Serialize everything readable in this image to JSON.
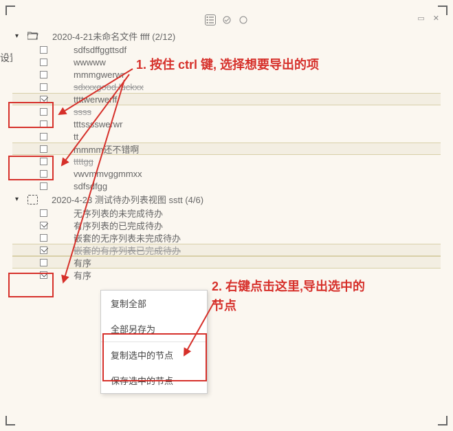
{
  "left_label": "设置",
  "topbar": {
    "list_icon": "≡",
    "check_icon": "✓",
    "circle_icon": "○"
  },
  "win": {
    "minimize": "▭",
    "close": "✕"
  },
  "groups": [
    {
      "title": "2020-4-21未命名文件 ffff (2/12)",
      "folder_type": "open",
      "items": [
        {
          "text": "sdfsdffggttsdf",
          "checked": false,
          "selected": false
        },
        {
          "text": "wwwww",
          "checked": false,
          "selected": false
        },
        {
          "text": "mmmgwerwr",
          "checked": false,
          "selected": false
        },
        {
          "text": "sdxxxgood luckxx",
          "checked": false,
          "selected": false,
          "done": true
        },
        {
          "text": "ttttwerwerff",
          "checked": true,
          "selected": true
        },
        {
          "text": "ssss",
          "checked": false,
          "selected": false,
          "done": true
        },
        {
          "text": "tttsssswerwr",
          "checked": false,
          "selected": false
        },
        {
          "text": "tt",
          "checked": false,
          "selected": false
        },
        {
          "text": "mmmm还不错啊",
          "checked": false,
          "selected": true
        },
        {
          "text": "ttttgg",
          "checked": false,
          "selected": false,
          "done": true
        },
        {
          "text": "vwvmmvggmmxx",
          "checked": false,
          "selected": false
        },
        {
          "text": "sdfsdfgg",
          "checked": false,
          "selected": false
        }
      ]
    },
    {
      "title": "2020-4-23 测试待办列表视图 sstt (4/6)",
      "folder_type": "dashed",
      "items": [
        {
          "text": "无序列表的未完成待办",
          "checked": false,
          "selected": false
        },
        {
          "text": "有序列表的已完成待办",
          "checked": true,
          "selected": false
        },
        {
          "text": "嵌套的无序列表未完成待办",
          "checked": false,
          "selected": false
        },
        {
          "text": "嵌套的有序列表已完成待办",
          "checked": true,
          "selected": true,
          "done": true
        },
        {
          "text": "有序",
          "checked": false,
          "selected": true
        },
        {
          "text": "有序",
          "checked": true,
          "selected": false
        }
      ]
    }
  ],
  "context_menu": {
    "copy_all": "复制全部",
    "save_all_as": "全部另存为",
    "copy_selected": "复制选中的节点",
    "save_selected": "保存选中的节点"
  },
  "annotations": {
    "step1": "1. 按住 ctrl 键, 选择想要导出的项",
    "step2a": "2. 右键点击这里,导出选中的",
    "step2b": "节点"
  }
}
